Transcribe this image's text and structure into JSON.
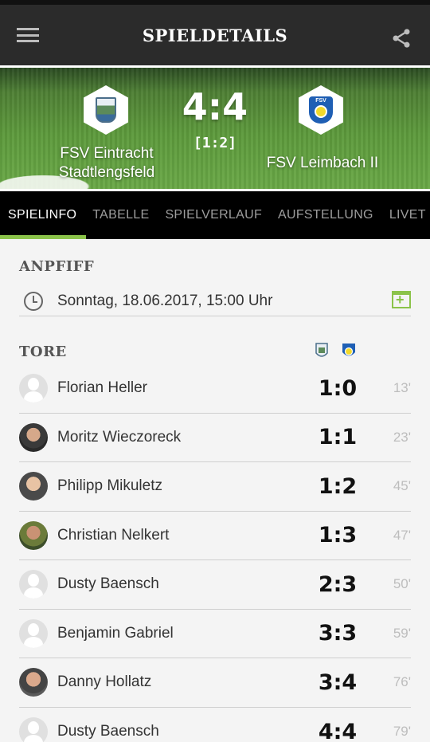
{
  "header": {
    "title": "SPIELDETAILS",
    "menu_icon": "menu-icon",
    "share_icon": "share-icon"
  },
  "match": {
    "home_team": "FSV Eintracht\nStadtlengsfeld",
    "away_team": "FSV Leimbach II",
    "score": "4:4",
    "halftime": "[1:2]",
    "away_crest_text": "FSV"
  },
  "tabs": [
    {
      "label": "SPIELINFO",
      "active": true
    },
    {
      "label": "TABELLE"
    },
    {
      "label": "SPIELVERLAUF"
    },
    {
      "label": "AUFSTELLUNG"
    },
    {
      "label": "LIVET"
    }
  ],
  "anpfiff": {
    "title": "ANPFIFF",
    "datetime": "Sonntag, 18.06.2017, 15:00 Uhr"
  },
  "tore": {
    "title": "TORE",
    "goals": [
      {
        "player": "Florian Heller",
        "score": "1:0",
        "minute": "13'",
        "avatar": "empty"
      },
      {
        "player": "Moritz Wieczoreck",
        "score": "1:1",
        "minute": "23'",
        "avatar": "photo"
      },
      {
        "player": "Philipp Mikuletz",
        "score": "1:2",
        "minute": "45'",
        "avatar": "photo"
      },
      {
        "player": "Christian Nelkert",
        "score": "1:3",
        "minute": "47'",
        "avatar": "photo"
      },
      {
        "player": "Dusty Baensch",
        "score": "2:3",
        "minute": "50'",
        "avatar": "empty"
      },
      {
        "player": "Benjamin Gabriel",
        "score": "3:3",
        "minute": "59'",
        "avatar": "empty"
      },
      {
        "player": "Danny Hollatz",
        "score": "3:4",
        "minute": "76'",
        "avatar": "photo"
      },
      {
        "player": "Dusty Baensch",
        "score": "4:4",
        "minute": "79'",
        "avatar": "empty"
      }
    ]
  },
  "colors": {
    "accent": "#8bc34a",
    "appbar": "#2b2b2b",
    "tabbar": "#000000"
  }
}
